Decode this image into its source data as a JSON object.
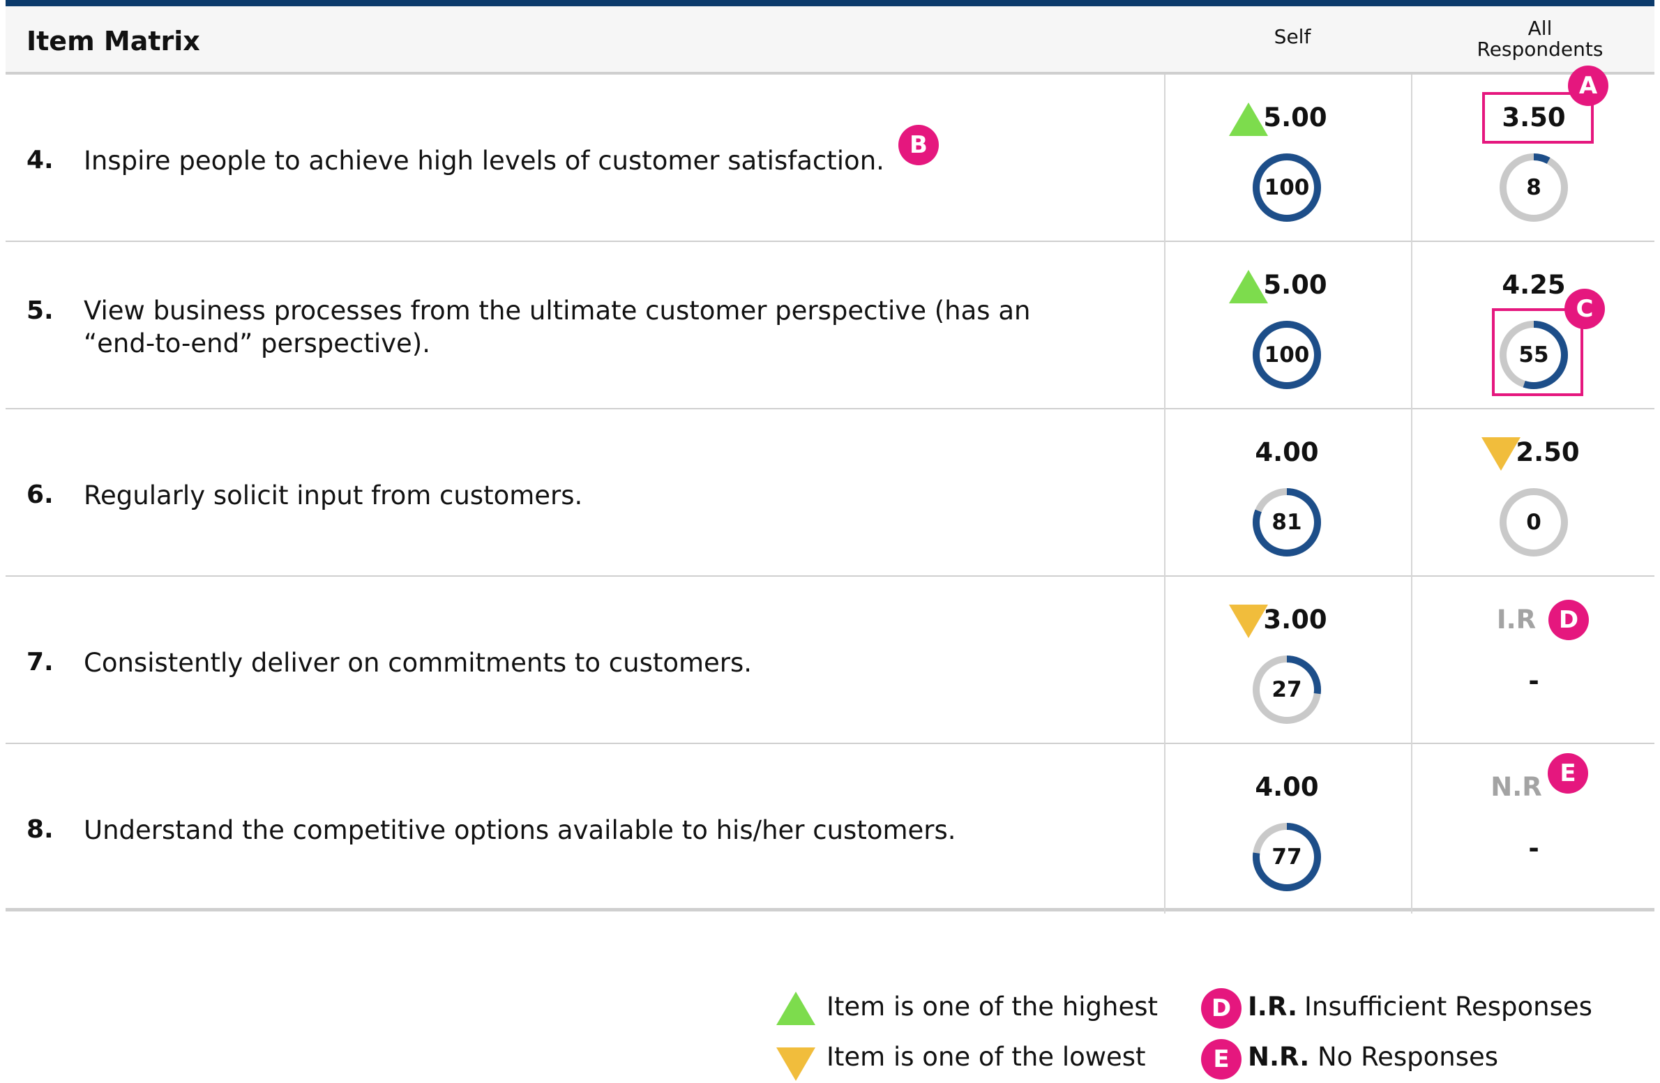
{
  "header": {
    "title": "Item Matrix",
    "col_self": "Self",
    "col_all": "All\nRespondents",
    "col_all_line1": "All",
    "col_all_line2": "Respondents"
  },
  "rows": [
    {
      "number": "4.",
      "text": "Inspire people to achieve high levels of customer satisfaction.",
      "self": {
        "score": "5.00",
        "indicator": "highest",
        "percent": 100,
        "percent_label": "100"
      },
      "all": {
        "score": "3.50",
        "indicator": "none",
        "percent": 8,
        "percent_label": "8"
      }
    },
    {
      "number": "5.",
      "text_line1": "View business processes from the ultimate customer perspective (has an",
      "text_line2": "“end-to-end” perspective).",
      "self": {
        "score": "5.00",
        "indicator": "highest",
        "percent": 100,
        "percent_label": "100"
      },
      "all": {
        "score": "4.25",
        "indicator": "none",
        "percent": 55,
        "percent_label": "55"
      }
    },
    {
      "number": "6.",
      "text": "Regularly solicit input from customers.",
      "self": {
        "score": "4.00",
        "indicator": "none",
        "percent": 81,
        "percent_label": "81"
      },
      "all": {
        "score": "2.50",
        "indicator": "lowest",
        "percent": 0,
        "percent_label": "0"
      }
    },
    {
      "number": "7.",
      "text": "Consistently deliver on commitments to customers.",
      "self": {
        "score": "3.00",
        "indicator": "lowest",
        "percent": 27,
        "percent_label": "27"
      },
      "all": {
        "score": "I.R",
        "indicator": "none",
        "value": "-"
      }
    },
    {
      "number": "8.",
      "text": "Understand the competitive options available to his/her customers.",
      "self": {
        "score": "4.00",
        "indicator": "none",
        "percent": 77,
        "percent_label": "77"
      },
      "all": {
        "score": "N.R",
        "indicator": "none",
        "value": "-"
      }
    }
  ],
  "markers": {
    "a": "A",
    "b": "B",
    "c": "C",
    "d": "D",
    "e": "E"
  },
  "legend": {
    "highest": "Item is one of the highest",
    "lowest": "Item is one of the lowest",
    "ir_abbr": "I.R.",
    "ir_text": "Insufficient Responses",
    "nr_abbr": "N.R.",
    "nr_text": "No Responses"
  },
  "colors": {
    "topbar": "#0b3a6b",
    "donut_fill": "#1d4e89",
    "donut_track": "#c9c9c9",
    "highest": "#7ddc4d",
    "lowest": "#f1bd3c",
    "marker": "#e5177e",
    "muted_text": "#a3a3a3"
  }
}
